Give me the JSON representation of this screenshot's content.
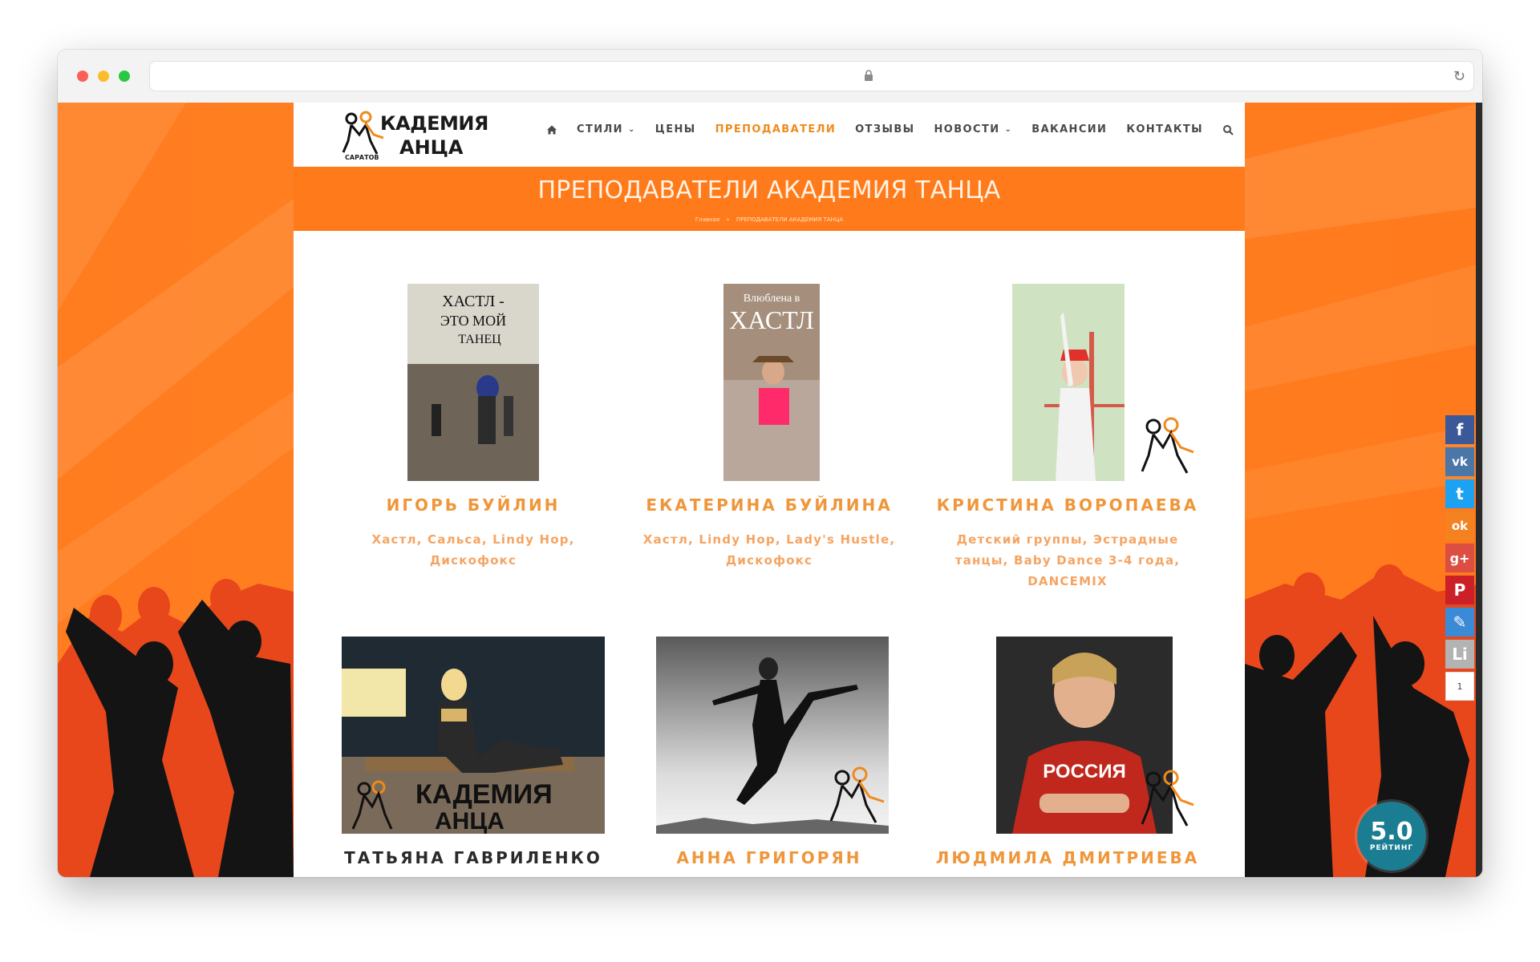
{
  "browser": {
    "url": "",
    "reload_icon": "↻"
  },
  "site": {
    "logo": {
      "line1": "КАДЕМИЯ",
      "line2": "АНЦА",
      "city": "САРАТОВ"
    },
    "nav": [
      {
        "label": "СТИЛИ",
        "caret": "⌄"
      },
      {
        "label": "ЦЕНЫ"
      },
      {
        "label": "ПРЕПОДАВАТЕЛИ",
        "active": true
      },
      {
        "label": "ОТЗЫВЫ"
      },
      {
        "label": "НОВОСТИ",
        "caret": "⌄"
      },
      {
        "label": "ВАКАНСИИ"
      },
      {
        "label": "КОНТАКТЫ"
      }
    ],
    "banner": {
      "title": "ПРЕПОДАВАТЕЛИ АКАДЕМИЯ ТАНЦА",
      "breadcrumb_home": "Главная",
      "breadcrumb_sep": "»",
      "breadcrumb_current": "ПРЕПОДАВАТЕЛИ АКАДЕМИЯ ТАНЦА"
    },
    "teachers": [
      {
        "name": "ИГОРЬ БУЙЛИН",
        "styles_line1": "Хастл, Сальса, Lindy Hop,",
        "styles_line2": "Дискофокс",
        "poster_text1": "ХАСТЛ -",
        "poster_text2": "ЭТО МОЙ",
        "poster_text3": "ТАНЕЦ"
      },
      {
        "name": "ЕКАТЕРИНА БУЙЛИНА",
        "styles_line1": "Хастл, Lindy Hop, Lady's Hustle,",
        "styles_line2": "Дискофокс",
        "poster_text1": "Влюблена в",
        "poster_text2": "ХАСТЛ"
      },
      {
        "name": "КРИСТИНА ВОРОПАЕВА",
        "styles_line1": "Детский группы, Эстрадные",
        "styles_line2": "танцы, Baby Dance 3-4 года,",
        "styles_line3": "DANCEMIX"
      },
      {
        "name": "ТАТЬЯНА ГАВРИЛЕНКО",
        "photo_logo": "КАДЕМИЯ",
        "photo_logo2": "АНЦА"
      },
      {
        "name": "АННА ГРИГОРЯН"
      },
      {
        "name": "ЛЮДМИЛА ДМИТРИЕВА",
        "shirt_text": "РОССИЯ"
      }
    ],
    "social": [
      {
        "name": "facebook",
        "glyph": "f",
        "color": "#3b5998"
      },
      {
        "name": "vk",
        "glyph": "vk",
        "color": "#4a76a8"
      },
      {
        "name": "twitter",
        "glyph": "t",
        "color": "#1da1f2"
      },
      {
        "name": "odnoklassniki",
        "glyph": "ok",
        "color": "#f58220"
      },
      {
        "name": "google-plus",
        "glyph": "g+",
        "color": "#dc4e41"
      },
      {
        "name": "pinterest",
        "glyph": "P",
        "color": "#cb2027"
      },
      {
        "name": "livejournal",
        "glyph": "✎",
        "color": "#3b8ad6"
      },
      {
        "name": "liveinternet",
        "glyph": "Li",
        "color": "#b3b3b3"
      }
    ],
    "share_count": "1",
    "rating": {
      "value": "5.0",
      "label": "РЕЙТИНГ"
    }
  }
}
